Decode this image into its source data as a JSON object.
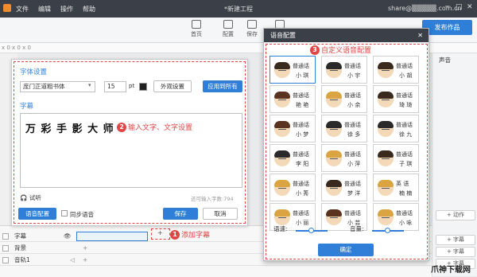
{
  "app": {
    "menu": [
      "文件",
      "编辑",
      "操作",
      "帮助"
    ],
    "title": "*新建工程",
    "user": "share@▒▒▒▒▒.com.cn",
    "window_controls": [
      "─",
      "□",
      "✕"
    ]
  },
  "toolbar": {
    "items": [
      {
        "label": "首页",
        "icon": "home-icon"
      },
      {
        "label": "配置",
        "icon": "settings-icon"
      },
      {
        "label": "保存",
        "icon": "save-icon"
      },
      {
        "label": "导出",
        "icon": "export-icon"
      }
    ],
    "publish": "发布作品"
  },
  "strip_text": "x 0 x 0 x 0",
  "subtitle_dialog": {
    "font_section": "字体设置",
    "font_name": "庞门正道粗书体",
    "font_size": "15",
    "font_unit": "pt",
    "appearance_btn": "外观设置",
    "apply_all_btn": "应用到所有",
    "subtitle_section": "字幕",
    "subtitle_text": "万 彩 手 影 大 师",
    "listen_label": "试听",
    "remaining": "还可输入字数:794",
    "voice_cfg_btn": "语音配置",
    "sync_voice": "同步语音",
    "save_btn": "保存",
    "cancel_btn": "取消"
  },
  "annotations": {
    "a1": {
      "num": "1",
      "text": "添加字幕"
    },
    "a2": {
      "num": "2",
      "text": "输入文字、文字设置"
    },
    "a3": {
      "num": "3",
      "text": "自定义语音配置"
    }
  },
  "voice_dialog": {
    "title": "语音配置",
    "close": "✕",
    "voices": [
      {
        "l1": "普通话",
        "l2": "小 琪",
        "hair": "#3a2a1e"
      },
      {
        "l1": "普通话",
        "l2": "小 宇",
        "hair": "#2a2a2a"
      },
      {
        "l1": "普通话",
        "l2": "小 胡",
        "hair": "#3a2a1e"
      },
      {
        "l1": "普通话",
        "l2": "艳 艳",
        "hair": "#5a3220"
      },
      {
        "l1": "普通话",
        "l2": "小 余",
        "hair": "#d9a441"
      },
      {
        "l1": "普通话",
        "l2": "琦 琦",
        "hair": "#3a2a1e"
      },
      {
        "l1": "普通话",
        "l2": "小 梦",
        "hair": "#5a3220"
      },
      {
        "l1": "普通话",
        "l2": "徐 多",
        "hair": "#2a2a2a"
      },
      {
        "l1": "普通话",
        "l2": "徐 九",
        "hair": "#2a2a2a"
      },
      {
        "l1": "普通话",
        "l2": "李 阳",
        "hair": "#2a2a2a"
      },
      {
        "l1": "普通话",
        "l2": "小 萍",
        "hair": "#d9a441"
      },
      {
        "l1": "普通话",
        "l2": "子 琪",
        "hair": "#3a2a1e"
      },
      {
        "l1": "普通话",
        "l2": "小 莠",
        "hair": "#d9a441"
      },
      {
        "l1": "普通话",
        "l2": "梦 洋",
        "hair": "#3a2a1e"
      },
      {
        "l1": "英 语",
        "l2": "楠 楠",
        "hair": "#d9a441"
      },
      {
        "l1": "普通话",
        "l2": "小 丽",
        "hair": "#d9a441"
      },
      {
        "l1": "普通话",
        "l2": "小 芸",
        "hair": "#5a3220"
      },
      {
        "l1": "普通话",
        "l2": "小 咏",
        "hair": "#d9a441"
      }
    ],
    "speed_label": "语速:",
    "volume_label": "音量:",
    "speed_value": 0.5,
    "volume_value": 0.5,
    "confirm": "确定"
  },
  "right_panel": {
    "sound": "声音",
    "buttons": [
      "+ 动作",
      "+ 字幕",
      "+ 字幕",
      "+ 字幕"
    ]
  },
  "timeline": {
    "tracks": [
      "字幕",
      "背景",
      "音轨1"
    ]
  },
  "watermark": "爪神下载网",
  "colors": {
    "accent": "#2f7fd8",
    "annotation": "#e04646",
    "titlebar": "#3b3f47"
  }
}
